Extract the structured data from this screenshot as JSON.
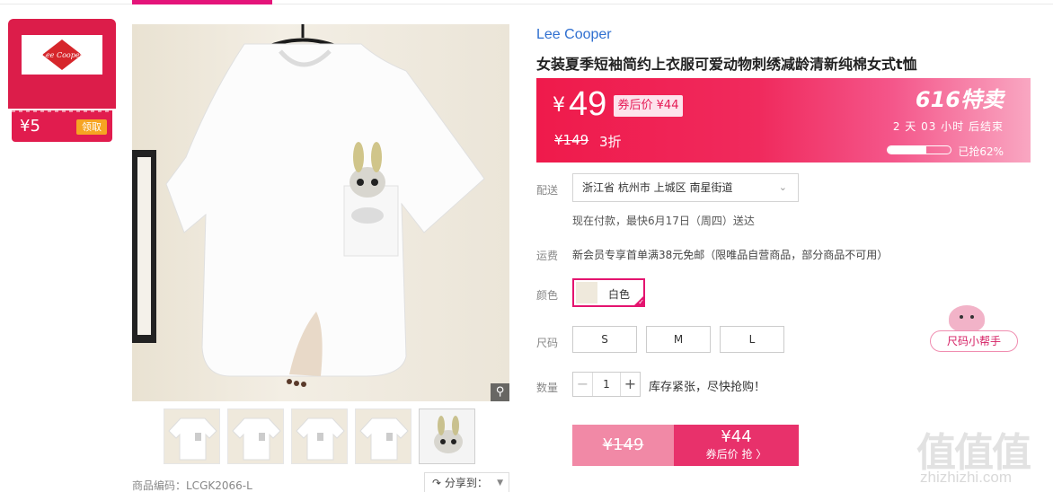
{
  "coupon": {
    "brand_logo": "Lee Cooper",
    "amount": "¥5",
    "claim_label": "领取"
  },
  "gallery": {
    "zoom_icon": "magnifier-icon",
    "thumbnail_count": 5,
    "sku_code": "商品编码：LCGK2066-L",
    "share_label": "分享到：",
    "share_icon": "share-icon"
  },
  "product": {
    "brand": "Lee Cooper",
    "title": "女装夏季短袖简约上衣服可爱动物刺绣减龄清新纯棉女式t恤"
  },
  "price": {
    "currency": "¥",
    "current": "49",
    "after_coupon": "券后价 ¥44",
    "original": "¥149",
    "discount": "3折",
    "promo_title": "616特卖",
    "countdown": "2 天 03 小时 后结束",
    "progress_fraction": 0.62,
    "grabbed": "已抢62%",
    "colors": {
      "accent": "#e4147a",
      "price_red": "#ef1a4b"
    }
  },
  "delivery": {
    "label": "配送",
    "address": "浙江省 杭州市 上城区 南星街道",
    "eta": "现在付款，最快6月17日（周四）送达"
  },
  "shipping": {
    "label": "运费",
    "text": "新会员专享首单满38元免邮（限唯品自营商品，部分商品不可用）"
  },
  "color": {
    "label": "颜色",
    "options": [
      "白色"
    ],
    "selected": "白色"
  },
  "size": {
    "label": "尺码",
    "options": [
      "S",
      "M",
      "L"
    ],
    "helper": "尺码小帮手"
  },
  "quantity": {
    "label": "数量",
    "value": "1",
    "minus": "−",
    "plus": "+",
    "stock_note": "库存紧张，尽快抢购！"
  },
  "buy": {
    "original_price": "¥149",
    "coupon_price": "¥44",
    "coupon_action": "券后价 抢 〉"
  },
  "watermark": {
    "glyphs": "值值值",
    "url": "zhizhizhi.com"
  }
}
